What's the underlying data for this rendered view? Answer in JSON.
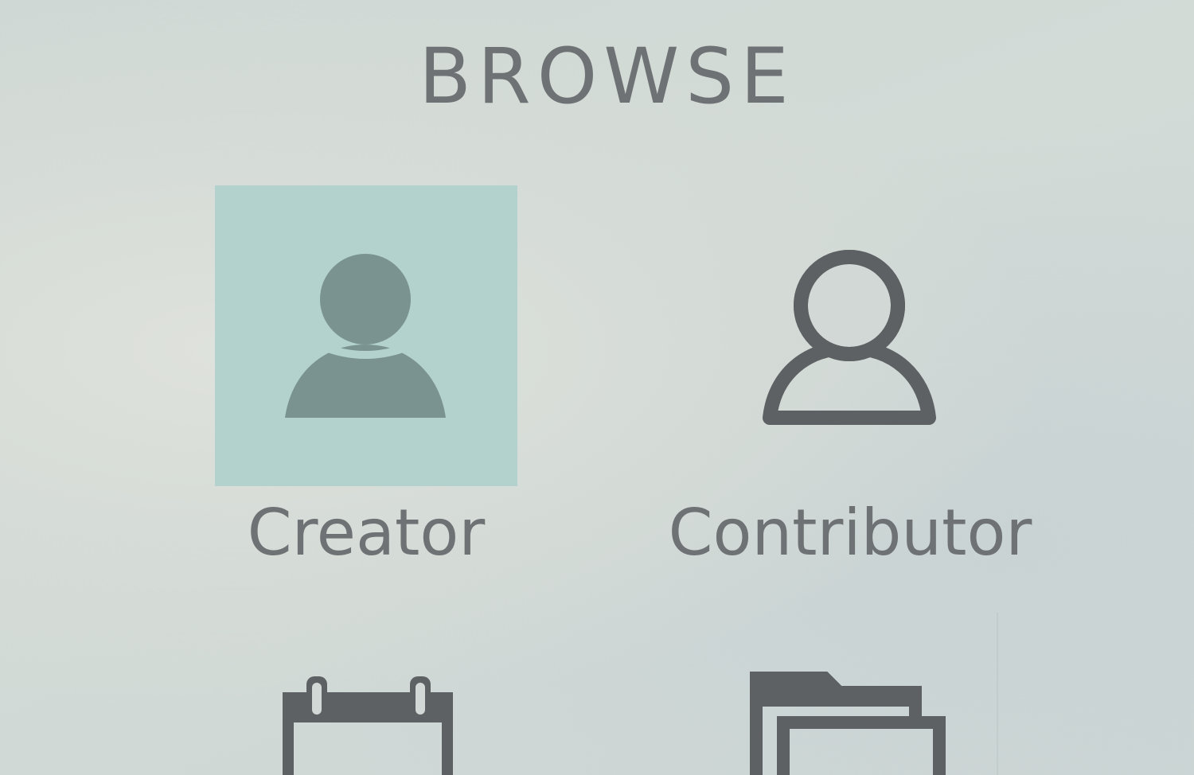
{
  "section": {
    "title": "BROWSE"
  },
  "tiles": [
    {
      "label": "Creator",
      "icon": "person-filled-icon",
      "selected": true
    },
    {
      "label": "Contributor",
      "icon": "person-outline-icon",
      "selected": false
    },
    {
      "label": "",
      "icon": "calendar-icon",
      "selected": false
    },
    {
      "label": "",
      "icon": "folders-icon",
      "selected": false
    }
  ],
  "colors": {
    "selected_bg": "#b3d2ce",
    "icon_dark": "#5e6163",
    "icon_selected": "#7a9290",
    "text": "#6f7274"
  }
}
